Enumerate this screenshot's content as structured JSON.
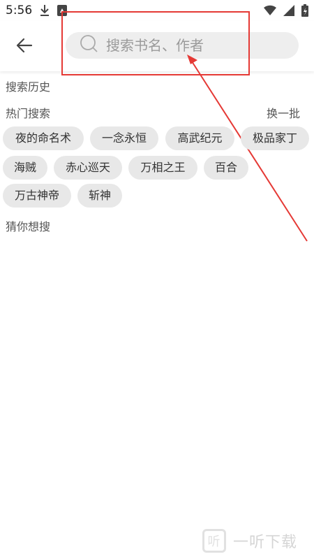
{
  "status_bar": {
    "time": "5:56",
    "icons": [
      "download-icon",
      "notification-icon",
      "wifi-icon",
      "signal-icon",
      "battery-charging-icon"
    ]
  },
  "header": {
    "back_icon": "arrow-left-icon",
    "search": {
      "placeholder": "搜索书名、作者",
      "value": ""
    },
    "search_icon": "search-icon"
  },
  "sections": {
    "history_title": "搜索历史",
    "hot_title": "热门搜索",
    "refresh_label": "换一批",
    "guess_title": "猜你想搜"
  },
  "hot_tags": [
    "夜的命名术",
    "一念永恒",
    "高武纪元",
    "极品家丁",
    "海贼",
    "赤心巡天",
    "万相之王",
    "百合",
    "万古神帝",
    "斩神"
  ],
  "annotation": {
    "color": "#e53935"
  },
  "watermark": {
    "logo_text": "听",
    "text": "一听下载"
  }
}
